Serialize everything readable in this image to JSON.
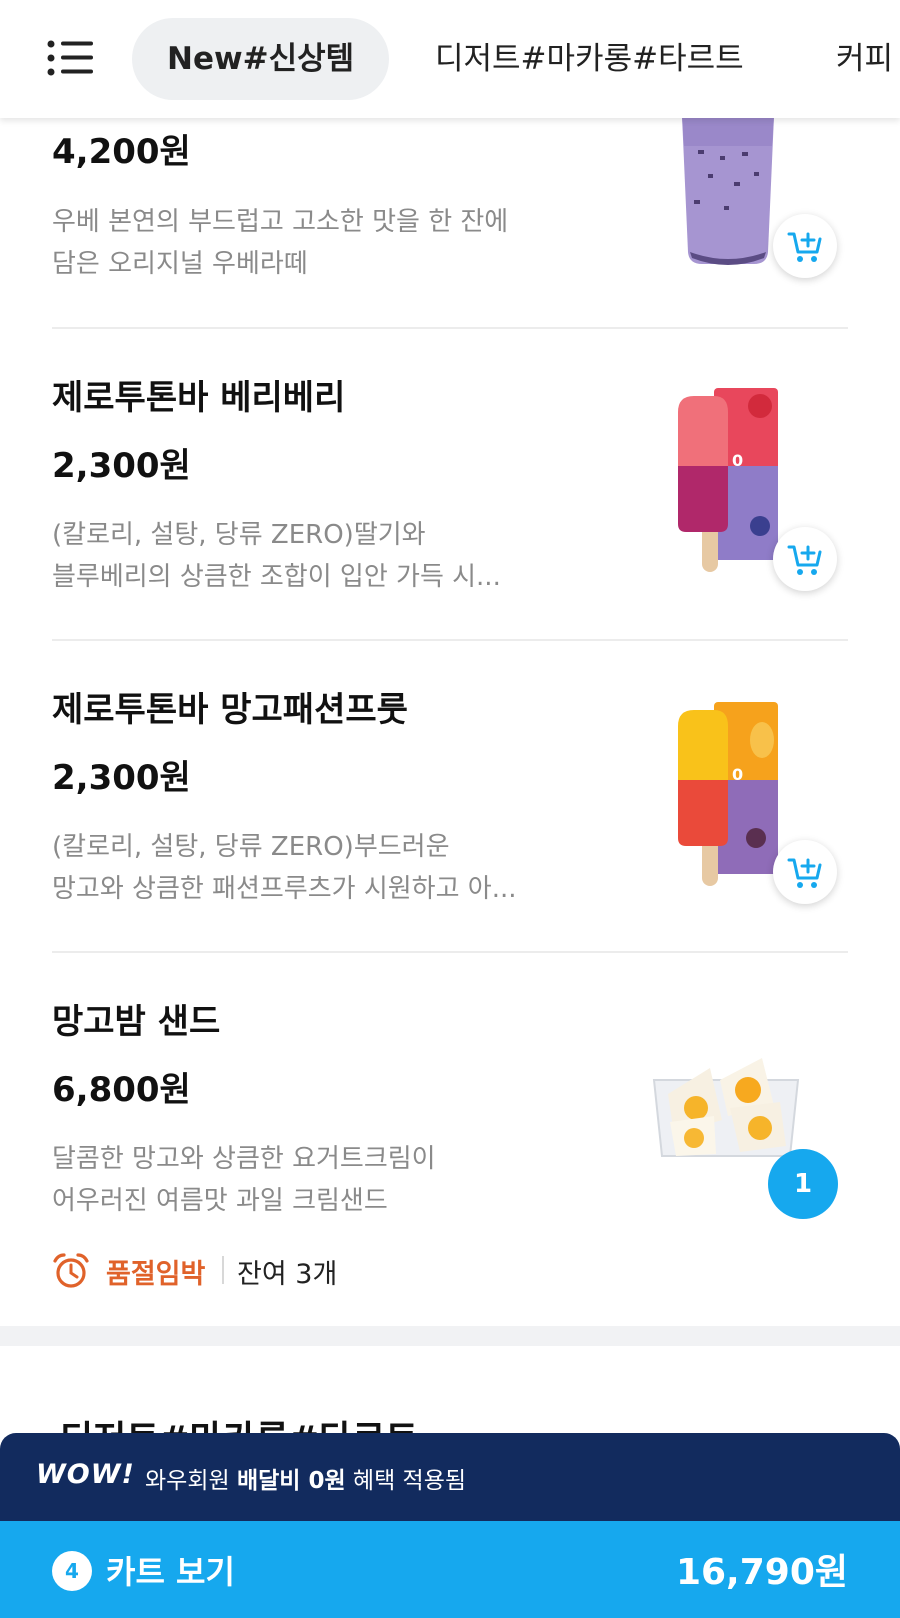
{
  "header": {
    "tabs": [
      {
        "label": "New#신상템",
        "active": true
      },
      {
        "label": "디저트#마카롱#타르트",
        "active": false
      },
      {
        "label": "커피",
        "active": false
      }
    ]
  },
  "products": [
    {
      "name": "",
      "price": "4,200원",
      "desc_line1": "우베 본연의 부드럽고 고소한 맛을 한 잔에",
      "desc_line2": "담은 오리지널 우베라떼"
    },
    {
      "name": "제로투톤바 베리베리",
      "price": "2,300원",
      "desc_line1": "(칼로리, 설탕, 당류 ZERO)딸기와",
      "desc_line2": "블루베리의 상큼한 조합이 입안 가득 시..."
    },
    {
      "name": "제로투톤바 망고패션프룻",
      "price": "2,300원",
      "desc_line1": "(칼로리, 설탕, 당류 ZERO)부드러운",
      "desc_line2": "망고와 상큼한 패션프루츠가 시원하고 아..."
    },
    {
      "name": "망고밤 샌드",
      "price": "6,800원",
      "desc_line1": "달콤한 망고와 상큼한 요거트크림이",
      "desc_line2": "어우러진 여름맛 과일 크림샌드",
      "quantity": "1",
      "stock_status": "품절임박",
      "stock_remaining": "잔여 3개"
    }
  ],
  "next_section_title": "디저트#마카롱#타르트",
  "wow_bar": {
    "logo": "WOW!",
    "text_prefix": "와우회원 ",
    "text_bold": "배달비 0원",
    "text_suffix": " 혜택 적용됨"
  },
  "cart_bar": {
    "count": "4",
    "label": "카트 보기",
    "total": "16,790원"
  },
  "colors": {
    "accent": "#16a8ee",
    "wow_navy": "#122b5e",
    "stock_alert": "#e0622a"
  },
  "icons": [
    "menu-icon",
    "cart-add-icon",
    "alarm-clock-icon"
  ]
}
